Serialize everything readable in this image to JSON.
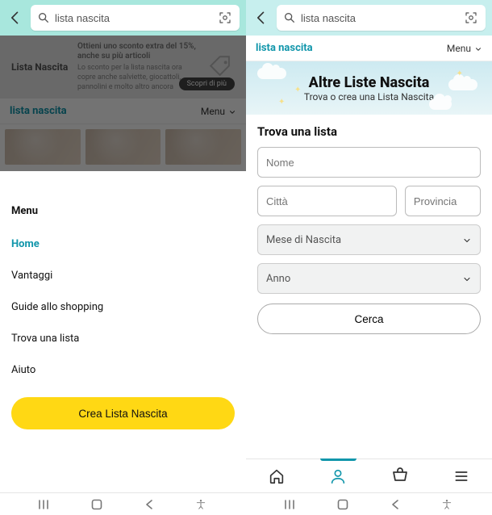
{
  "search": {
    "query": "lista nascita",
    "placeholder": "Cerca"
  },
  "brand_label": "lista nascita",
  "menu_dropdown_label": "Menu",
  "left": {
    "promo": {
      "title": "Lista Nascita",
      "line1": "Ottieni uno sconto extra del 15%, anche su più articoli",
      "line2": "Lo sconto per la lista nascita ora copre anche salviette, giocattoli, pannolini e molto altro ancora",
      "cta": "Scopri di più"
    },
    "menu_title": "Menu",
    "menu_items": [
      {
        "label": "Home",
        "active": true
      },
      {
        "label": "Vantaggi",
        "active": false
      },
      {
        "label": "Guide allo shopping",
        "active": false
      },
      {
        "label": "Trova una lista",
        "active": false
      },
      {
        "label": "Aiuto",
        "active": false
      }
    ],
    "cta_label": "Crea Lista Nascita"
  },
  "right": {
    "hero_title": "Altre Liste Nascita",
    "hero_sub": "Trova o crea una Lista Nascita",
    "form_title": "Trova una lista",
    "name_placeholder": "Nome",
    "city_placeholder": "Città",
    "province_placeholder": "Provincia",
    "month_label": "Mese di Nascita",
    "year_label": "Anno",
    "search_button": "Cerca"
  }
}
